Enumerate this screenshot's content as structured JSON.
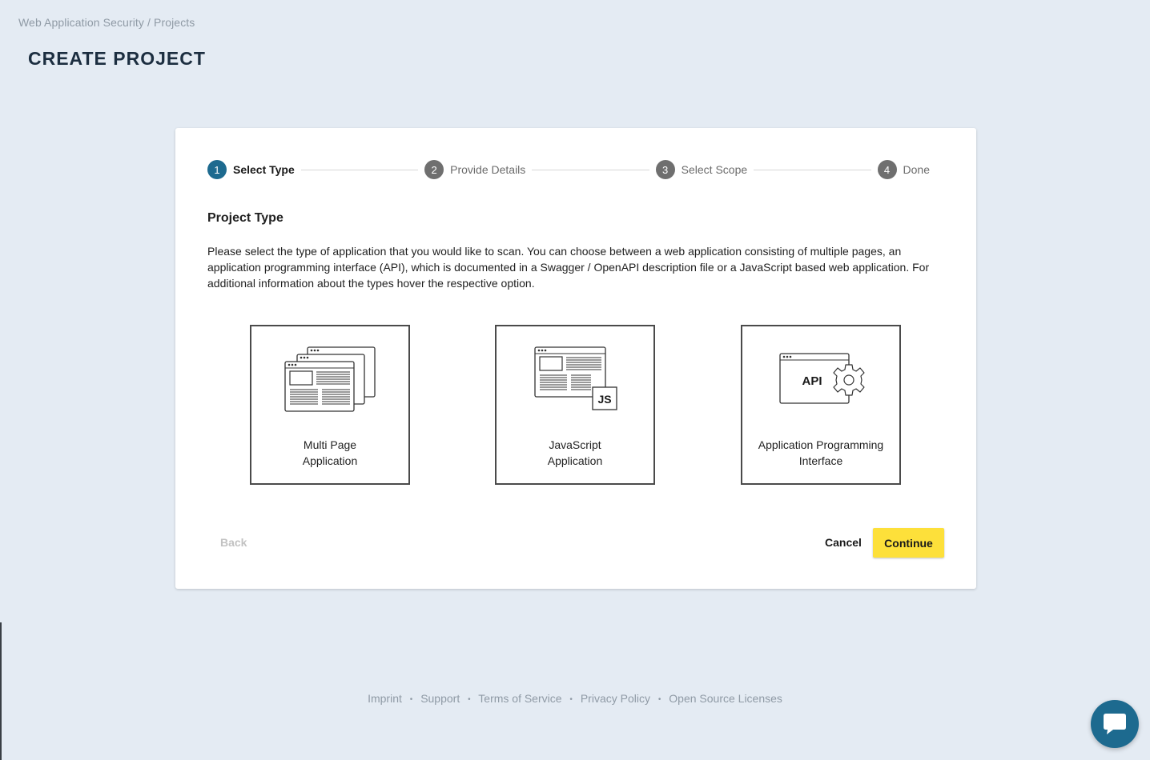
{
  "breadcrumb": {
    "parent": "Web Application Security",
    "separator": "/",
    "current": "Projects"
  },
  "page_title": "CREATE PROJECT",
  "stepper": {
    "steps": [
      {
        "number": "1",
        "label": "Select Type",
        "active": true
      },
      {
        "number": "2",
        "label": "Provide Details",
        "active": false
      },
      {
        "number": "3",
        "label": "Select Scope",
        "active": false
      },
      {
        "number": "4",
        "label": "Done",
        "active": false
      }
    ]
  },
  "section_title": "Project Type",
  "description": "Please select the type of application that you would like to scan. You can choose between a web application consisting of multiple pages, an application programming interface (API), which is documented in a Swagger / OpenAPI description file or a JavaScript based web application. For additional information about the types hover the respective option.",
  "options": [
    {
      "label": "Multi Page\nApplication",
      "icon": "multi-page-app-icon"
    },
    {
      "label": "JavaScript\nApplication",
      "icon": "javascript-app-icon",
      "badge": "JS"
    },
    {
      "label": "Application Programming\nInterface",
      "icon": "api-icon",
      "badge": "API"
    }
  ],
  "buttons": {
    "back": "Back",
    "cancel": "Cancel",
    "continue": "Continue"
  },
  "footer": {
    "separator": "•",
    "links": [
      "Imprint",
      "Support",
      "Terms of Service",
      "Privacy Policy",
      "Open Source Licenses"
    ]
  },
  "colors": {
    "background": "#e4ebf3",
    "accent": "#1d6a8f",
    "primary_button": "#fde03a",
    "title": "#1c2e40"
  },
  "chat": {
    "icon": "chat-bubble-icon"
  }
}
